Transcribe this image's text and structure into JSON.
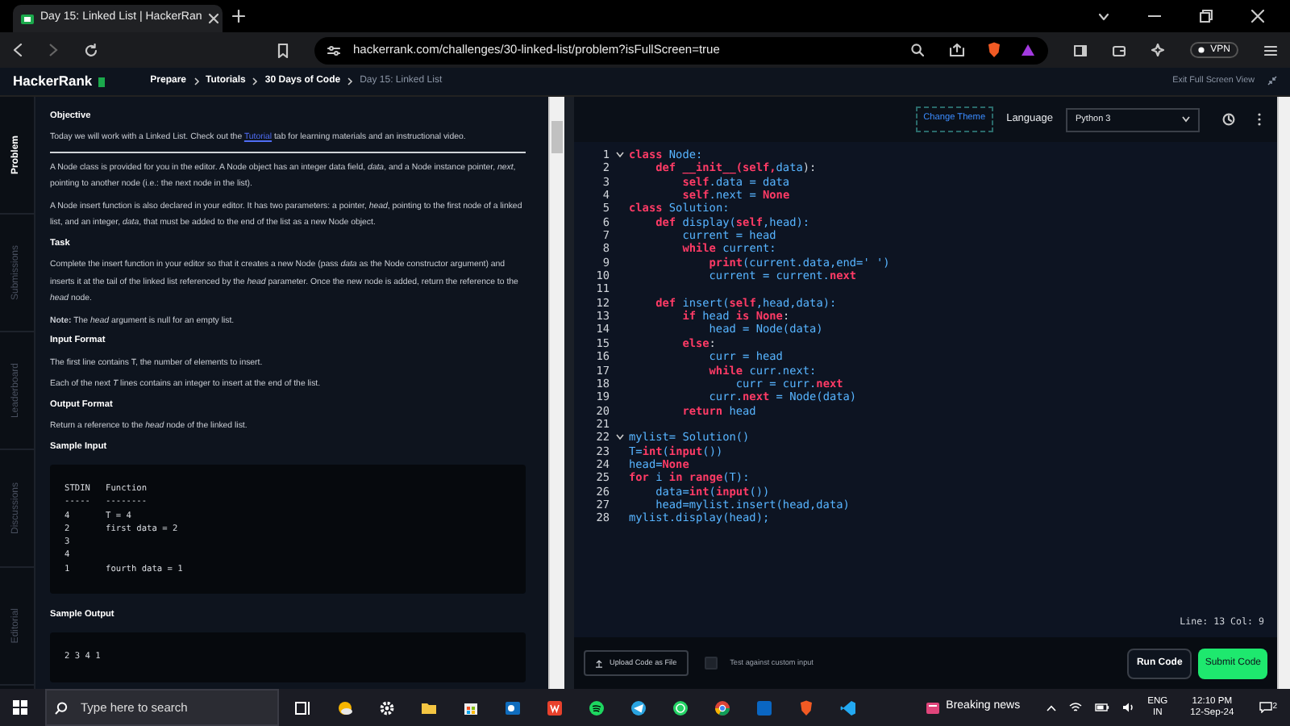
{
  "browser": {
    "tab_title": "Day 15: Linked List | HackerRan",
    "url": "hackerrank.com/challenges/30-linked-list/problem?isFullScreen=true",
    "vpn_label": "VPN"
  },
  "header": {
    "logo": "HackerRank",
    "breadcrumbs": [
      {
        "label": "Prepare",
        "current": false
      },
      {
        "label": "Tutorials",
        "current": false
      },
      {
        "label": "30 Days of Code",
        "current": false
      },
      {
        "label": "Day 15: Linked List",
        "current": true
      }
    ],
    "exit_label": "Exit Full Screen View"
  },
  "side_tabs": [
    {
      "label": "Problem",
      "selected": true
    },
    {
      "label": "Submissions",
      "selected": false
    },
    {
      "label": "Leaderboard",
      "selected": false
    },
    {
      "label": "Discussions",
      "selected": false
    },
    {
      "label": "Editorial",
      "selected": false
    }
  ],
  "problem": [
    {
      "kind": "heading",
      "text": "Objective"
    },
    {
      "kind": "linked",
      "parts": [
        {
          "kind": "text",
          "text": "Today we will work with a Linked List. Check out the "
        },
        {
          "kind": "link",
          "text": "Tutorial"
        },
        {
          "kind": "text",
          "text": " tab for learning materials and an instructional video."
        }
      ]
    },
    {
      "kind": "rule"
    },
    {
      "kind": "paragraph",
      "text": "A Node class is provided for you in the editor. A Node object has an integer data field, *data*, and a Node instance pointer, *next*, pointing to another node (i.e.: the next node in the list)."
    },
    {
      "kind": "paragraph",
      "text": "A Node insert function is also declared in your editor. It has two parameters: a pointer, *head*, pointing to the first node of a linked list, and an integer, *data*, that must be added to the end of the list as a new Node object."
    },
    {
      "kind": "heading",
      "text": "Task"
    },
    {
      "kind": "paragraph",
      "text": "Complete the insert function in your editor so that it creates a new Node (pass *data* as the Node constructor argument) and inserts it at the tail of the linked list referenced by the *head* parameter. Once the new node is added, return the reference to the *head* node."
    },
    {
      "kind": "paragraph",
      "text": "**Note:** The *head* argument is null for an empty list."
    },
    {
      "kind": "heading",
      "text": "Input Format"
    },
    {
      "kind": "paragraph",
      "text": "The first line contains T, the number of elements to insert."
    },
    {
      "kind": "paragraph",
      "text": "Each of the next *T* lines contains an integer to insert at the end of the list."
    },
    {
      "kind": "heading",
      "text": "Output Format"
    },
    {
      "kind": "paragraph",
      "text": "Return a reference to the *head* node of the linked list."
    },
    {
      "kind": "heading",
      "text": "Sample Input"
    },
    {
      "kind": "code",
      "lines": [
        "STDIN   Function",
        "-----   --------",
        "4       T = 4",
        "2       first data = 2",
        "3",
        "4",
        "1       fourth data = 1"
      ]
    },
    {
      "kind": "heading",
      "text": "Sample Output"
    },
    {
      "kind": "code",
      "lines": [
        "2 3 4 1"
      ]
    }
  ],
  "editor": {
    "theme_button": "Change Theme",
    "language_label": "Language",
    "language": "Python 3",
    "lines": [
      {
        "number": "1",
        "fold": true,
        "tokens": [
          {
            "text": "class ",
            "kind": "k"
          },
          {
            "text": "Node:",
            "kind": "v"
          }
        ]
      },
      {
        "number": "2",
        "fold": false,
        "tokens": [
          {
            "text": "    def __init__(self,",
            "kind": "k"
          },
          {
            "text": "data",
            "kind": "v"
          },
          {
            "text": "):",
            "kind": "o"
          }
        ]
      },
      {
        "number": "3",
        "fold": false,
        "tokens": [
          {
            "text": "        self",
            "kind": "k"
          },
          {
            "text": ".data = data",
            "kind": "v"
          }
        ]
      },
      {
        "number": "4",
        "fold": false,
        "tokens": [
          {
            "text": "        self",
            "kind": "k"
          },
          {
            "text": ".next = ",
            "kind": "v"
          },
          {
            "text": "None",
            "kind": "k"
          }
        ]
      },
      {
        "number": "5",
        "fold": false,
        "tokens": [
          {
            "text": "class ",
            "kind": "k"
          },
          {
            "text": "Solution:",
            "kind": "v"
          }
        ]
      },
      {
        "number": "6",
        "fold": false,
        "tokens": [
          {
            "text": "    def ",
            "kind": "k"
          },
          {
            "text": "display(",
            "kind": "v"
          },
          {
            "text": "self",
            "kind": "k"
          },
          {
            "text": ",head):",
            "kind": "v"
          }
        ]
      },
      {
        "number": "7",
        "fold": false,
        "tokens": [
          {
            "text": "        current = head",
            "kind": "v"
          }
        ]
      },
      {
        "number": "8",
        "fold": false,
        "tokens": [
          {
            "text": "        while ",
            "kind": "k"
          },
          {
            "text": "current:",
            "kind": "v"
          }
        ]
      },
      {
        "number": "9",
        "fold": false,
        "tokens": [
          {
            "text": "            print",
            "kind": "k"
          },
          {
            "text": "(current.data,end=' ')",
            "kind": "v"
          }
        ]
      },
      {
        "number": "10",
        "fold": false,
        "tokens": [
          {
            "text": "            current = current.",
            "kind": "v"
          },
          {
            "text": "next",
            "kind": "k"
          }
        ]
      },
      {
        "number": "11",
        "fold": false
      },
      {
        "number": "12",
        "fold": false,
        "tokens": [
          {
            "text": "    def ",
            "kind": "k"
          },
          {
            "text": "insert(",
            "kind": "v"
          },
          {
            "text": "self",
            "kind": "k"
          },
          {
            "text": ",head,data):",
            "kind": "v"
          }
        ]
      },
      {
        "number": "13",
        "fold": false,
        "tokens": [
          {
            "text": "        if ",
            "kind": "k"
          },
          {
            "text": "head ",
            "kind": "v"
          },
          {
            "text": "is None",
            "kind": "k"
          },
          {
            "text": ":",
            "kind": "o"
          }
        ]
      },
      {
        "number": "14",
        "fold": false,
        "tokens": [
          {
            "text": "            head = Node(data)",
            "kind": "v"
          }
        ]
      },
      {
        "number": "15",
        "fold": false,
        "tokens": [
          {
            "text": "        else",
            "kind": "k"
          },
          {
            "text": ":",
            "kind": "o"
          }
        ]
      },
      {
        "number": "16",
        "fold": false,
        "tokens": [
          {
            "text": "            curr = head",
            "kind": "v"
          }
        ]
      },
      {
        "number": "17",
        "fold": false,
        "tokens": [
          {
            "text": "            while ",
            "kind": "k"
          },
          {
            "text": "curr.next:",
            "kind": "v"
          }
        ]
      },
      {
        "number": "18",
        "fold": false,
        "tokens": [
          {
            "text": "                curr = curr.",
            "kind": "v"
          },
          {
            "text": "next",
            "kind": "k"
          }
        ]
      },
      {
        "number": "19",
        "fold": false,
        "tokens": [
          {
            "text": "            curr.",
            "kind": "v"
          },
          {
            "text": "next",
            "kind": "k"
          },
          {
            "text": " = Node(data)",
            "kind": "v"
          }
        ]
      },
      {
        "number": "20",
        "fold": false,
        "tokens": [
          {
            "text": "        return ",
            "kind": "k"
          },
          {
            "text": "head",
            "kind": "v"
          }
        ]
      },
      {
        "number": "21",
        "fold": false
      },
      {
        "number": "22",
        "fold": true,
        "tokens": [
          {
            "text": "mylist= Solution()",
            "kind": "v"
          }
        ]
      },
      {
        "number": "23",
        "fold": false,
        "tokens": [
          {
            "text": "T=",
            "kind": "v"
          },
          {
            "text": "int",
            "kind": "k"
          },
          {
            "text": "(",
            "kind": "v"
          },
          {
            "text": "input",
            "kind": "k"
          },
          {
            "text": "())",
            "kind": "v"
          }
        ]
      },
      {
        "number": "24",
        "fold": false,
        "tokens": [
          {
            "text": "head=",
            "kind": "v"
          },
          {
            "text": "None",
            "kind": "k"
          }
        ]
      },
      {
        "number": "25",
        "fold": false,
        "tokens": [
          {
            "text": "for ",
            "kind": "k"
          },
          {
            "text": "i ",
            "kind": "v"
          },
          {
            "text": "in range",
            "kind": "k"
          },
          {
            "text": "(T):",
            "kind": "v"
          }
        ]
      },
      {
        "number": "26",
        "fold": false,
        "tokens": [
          {
            "text": "    data=",
            "kind": "v"
          },
          {
            "text": "int",
            "kind": "k"
          },
          {
            "text": "(",
            "kind": "v"
          },
          {
            "text": "input",
            "kind": "k"
          },
          {
            "text": "())",
            "kind": "v"
          }
        ]
      },
      {
        "number": "27",
        "fold": false,
        "tokens": [
          {
            "text": "    head=mylist.insert(head,data)",
            "kind": "v"
          }
        ]
      },
      {
        "number": "28",
        "fold": false,
        "tokens": [
          {
            "text": "mylist.display(head);",
            "kind": "v"
          }
        ]
      }
    ],
    "cursor_status": "Line: 13 Col: 9",
    "upload_button": "Upload Code as File",
    "custom_input": {
      "label": "Test against custom input",
      "checked": false
    },
    "run_button": "Run Code",
    "submit_button": "Submit Code"
  },
  "taskbar": {
    "search_placeholder": "Type here to search",
    "news": "Breaking news",
    "language": "ENG",
    "region": "IN",
    "time": "12:10 PM",
    "date": "12-Sep-24",
    "notifications": "2"
  }
}
